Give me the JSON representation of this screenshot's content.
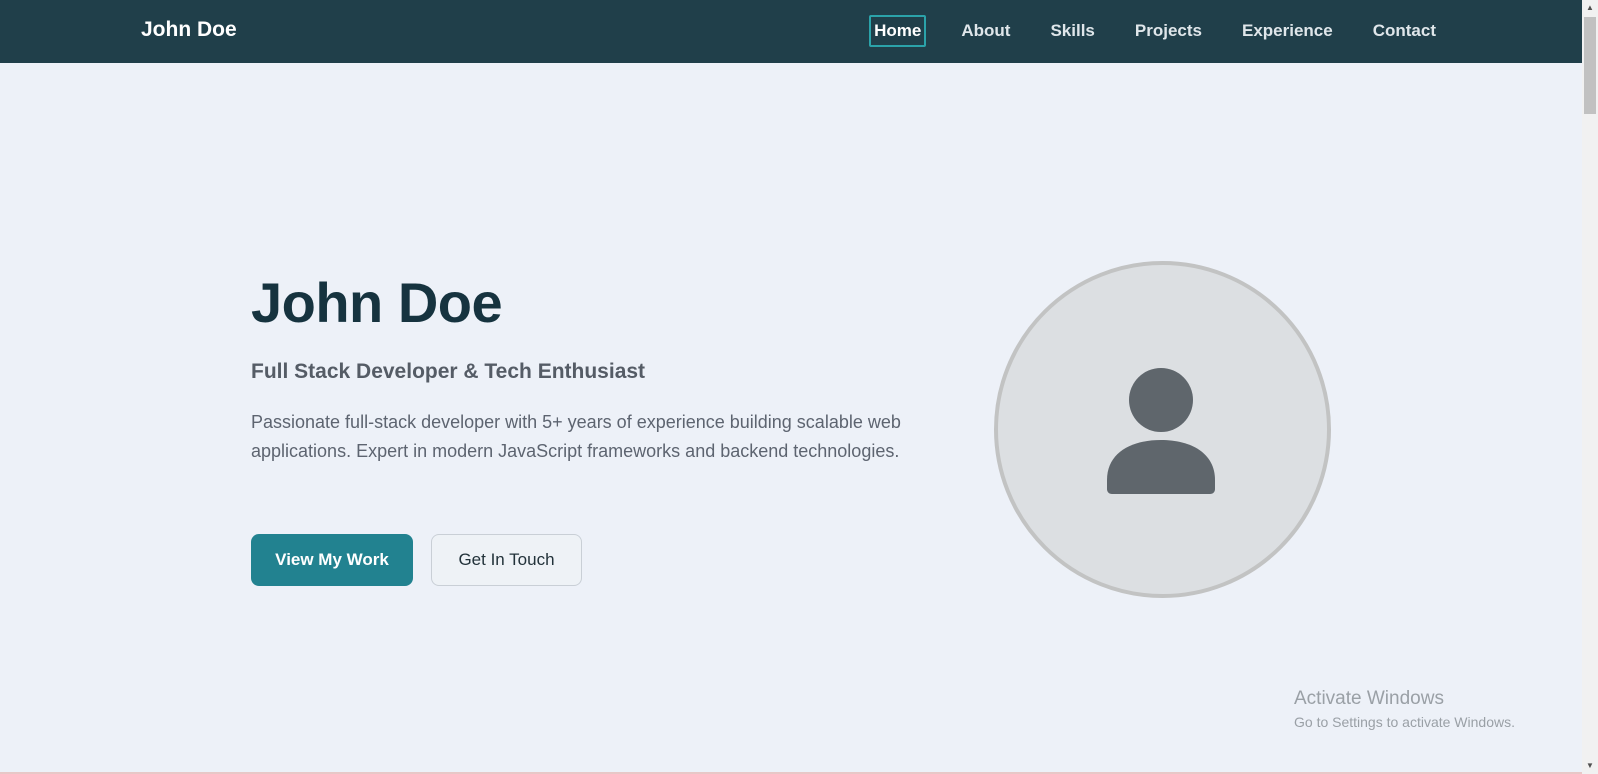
{
  "nav": {
    "brand": "John Doe",
    "links": [
      {
        "label": "Home",
        "active": true
      },
      {
        "label": "About"
      },
      {
        "label": "Skills"
      },
      {
        "label": "Projects"
      },
      {
        "label": "Experience"
      },
      {
        "label": "Contact"
      }
    ]
  },
  "hero": {
    "name": "John Doe",
    "subtitle": "Full Stack Developer & Tech Enthusiast",
    "description": "Passionate full-stack developer with 5+ years of experience building scalable web applications. Expert in modern JavaScript frameworks and backend technologies.",
    "primary_button": "View My Work",
    "secondary_button": "Get In Touch",
    "avatar_icon": "user-icon"
  },
  "watermark": {
    "title": "Activate Windows",
    "subtitle": "Go to Settings to activate Windows."
  },
  "colors": {
    "nav_background": "#203f4a",
    "page_background": "#edf1f8",
    "accent": "#228290",
    "heading": "#16333f"
  }
}
